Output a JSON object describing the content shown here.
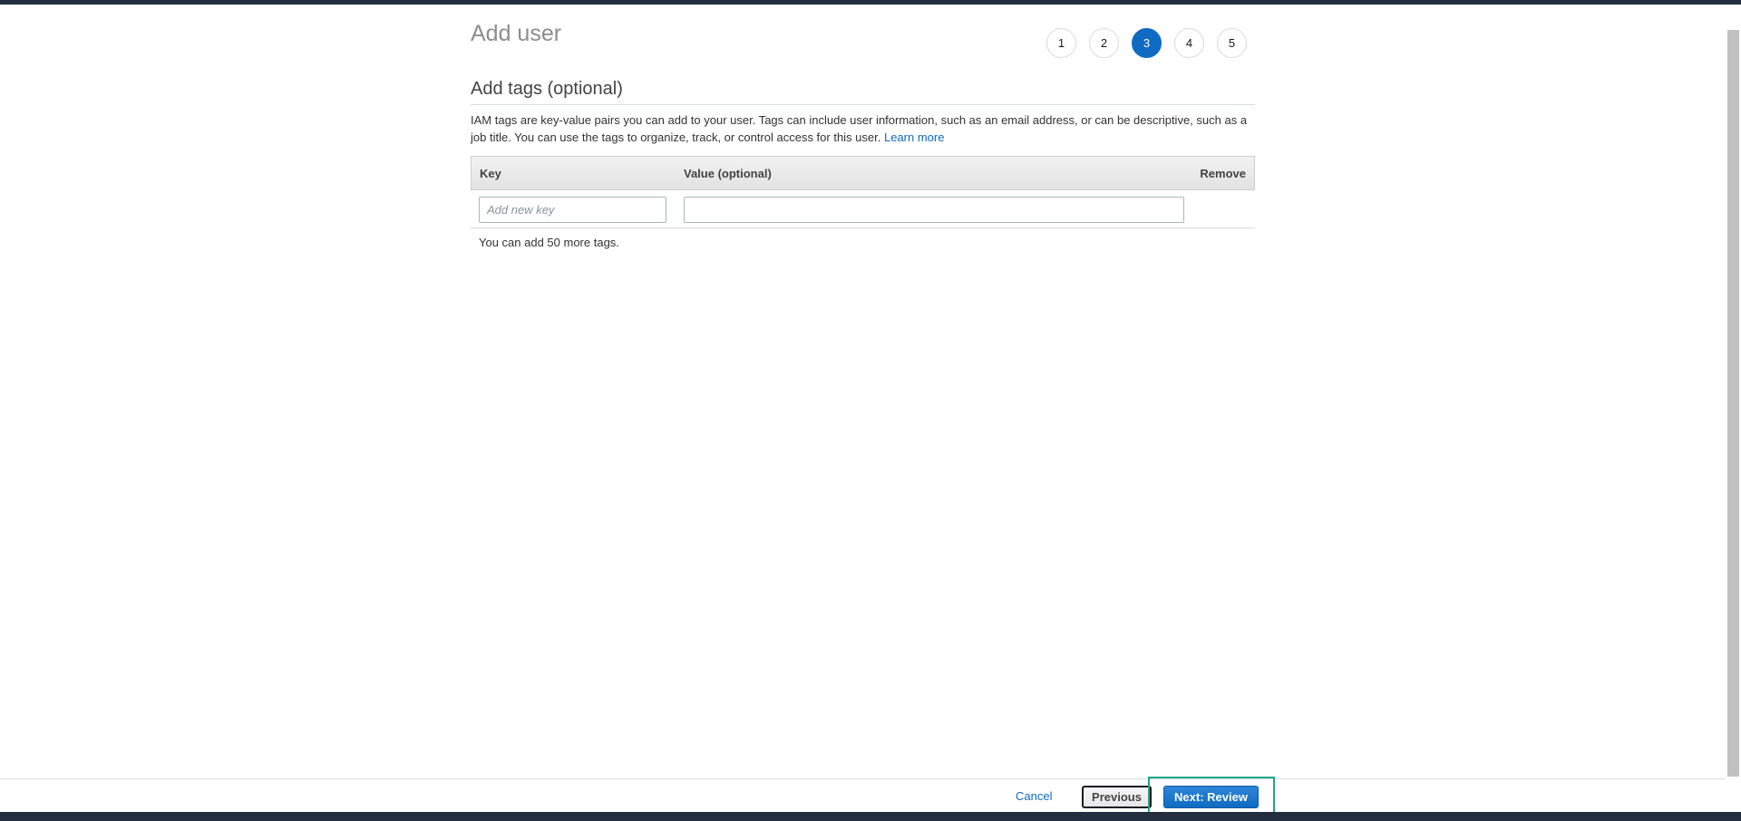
{
  "page": {
    "title": "Add user"
  },
  "stepper": {
    "steps": [
      "1",
      "2",
      "3",
      "4",
      "5"
    ],
    "active_step": "3"
  },
  "section": {
    "title": "Add tags (optional)",
    "description": "IAM tags are key-value pairs you can add to your user. Tags can include user information, such as an email address, or can be descriptive, such as a job title. You can use the tags to organize, track, or control access for this user.",
    "learn_more": "Learn more"
  },
  "tags_table": {
    "headers": {
      "key": "Key",
      "value": "Value (optional)",
      "remove": "Remove"
    },
    "row": {
      "key_placeholder": "Add new key",
      "key_value": "",
      "value_value": ""
    },
    "remaining_text": "You can add 50 more tags."
  },
  "footer": {
    "cancel": "Cancel",
    "previous": "Previous",
    "next": "Next: Review"
  },
  "colors": {
    "accent": "#0f6ac2",
    "header_strip": "#232f3e",
    "focus_ring": "#1fa68b"
  }
}
